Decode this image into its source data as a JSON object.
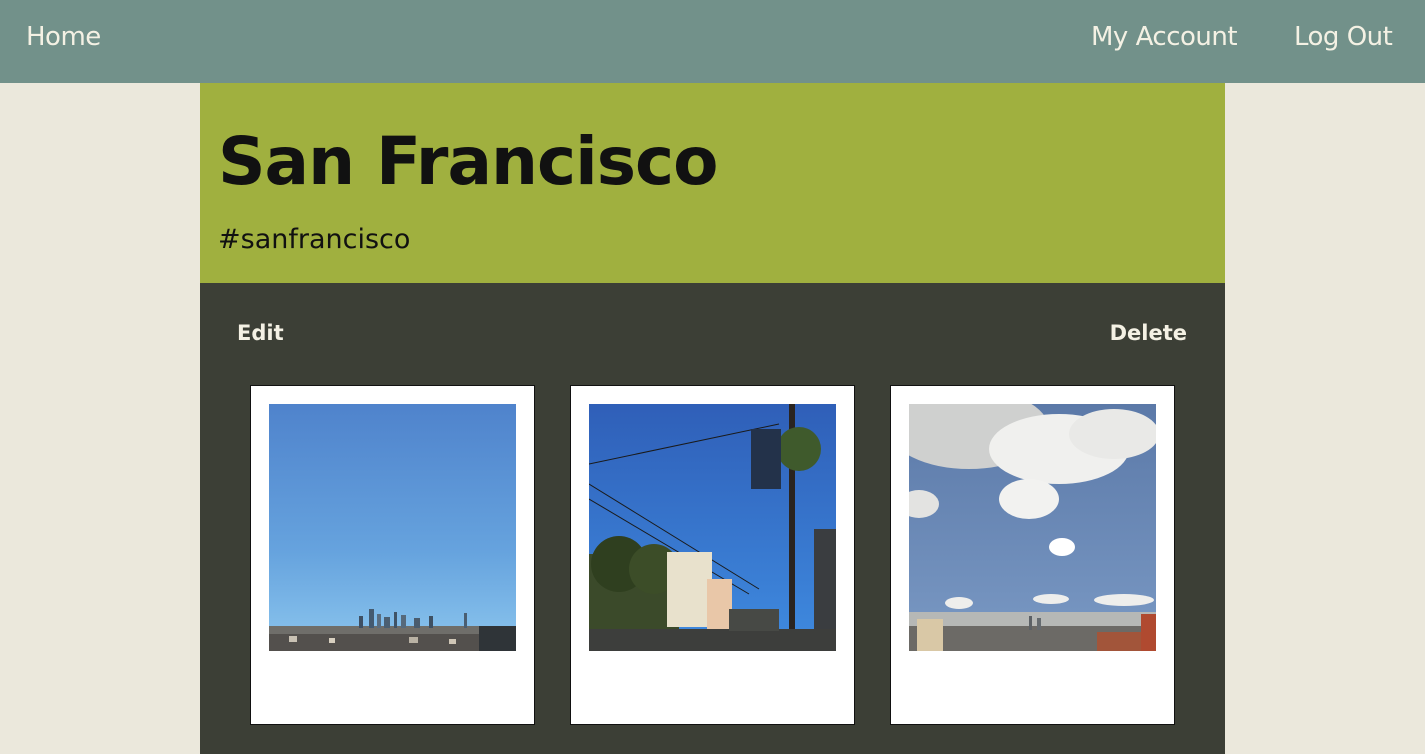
{
  "nav": {
    "home": "Home",
    "my_account": "My Account",
    "log_out": "Log Out"
  },
  "board": {
    "title": "San Francisco",
    "hashtag": "#sanfrancisco",
    "edit_label": "Edit",
    "delete_label": "Delete"
  },
  "colors": {
    "nav_bg": "#72918a",
    "page_bg": "#ebe8dc",
    "header_bg": "#a0b03f",
    "body_bg": "#3c3f36"
  },
  "photos": [
    {
      "name": "skyline-clear-sky-photo"
    },
    {
      "name": "street-palm-tree-photo"
    },
    {
      "name": "clouds-over-city-photo"
    }
  ]
}
